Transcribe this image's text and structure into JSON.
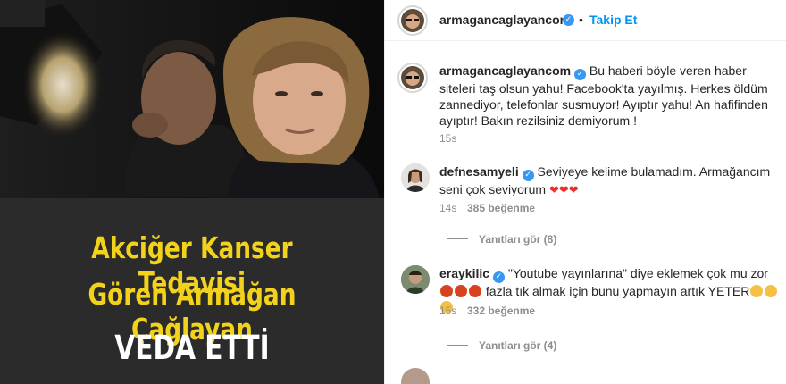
{
  "post_image": {
    "caption_line1": "Akciğer Kanser Tedavisi",
    "caption_line2": "Gören Armağan Çağlayan",
    "caption_line3": "VEDA ETTİ"
  },
  "header": {
    "username": "armagancaglayancom",
    "separator": "•",
    "follow_label": "Takip Et"
  },
  "caption_comment": {
    "username": "armagancaglayancom",
    "text": "Bu haberi böyle veren haber siteleri taş olsun yahu! Facebook'ta yayılmış. Herkes öldüm zannediyor, telefonlar susmuyor! Ayıptır yahu! An hafifinden ayıptır! Bakın rezilsiniz demiyorum !",
    "time": "15s"
  },
  "comments": [
    {
      "username": "defnesamyeli",
      "text": "Seviyeye kelime bulamadım. Armağancım seni çok seviyorum",
      "hearts": "❤❤❤",
      "time": "14s",
      "likes": "385 beğenme",
      "replies": "Yanıtları gör (8)"
    },
    {
      "username": "eraykilic",
      "text_a": "\"Youtube yayınlarına\" diye eklemek çok mu zor",
      "text_b": "fazla tık almak için bunu yapmayın artık YETER",
      "time": "15s",
      "likes": "332 beğenme",
      "replies": "Yanıtları gör (4)"
    }
  ],
  "icons": {
    "verified": "verified-badge-icon",
    "heart": "heart-emoji-icon",
    "angry": "angry-face-emoji-icon",
    "sad": "sad-face-emoji-icon"
  },
  "colors": {
    "accent_blue": "#0095f6",
    "verified_blue": "#3897f0",
    "caption_yellow": "#f2d21b",
    "muted_gray": "#8e8e8e"
  }
}
